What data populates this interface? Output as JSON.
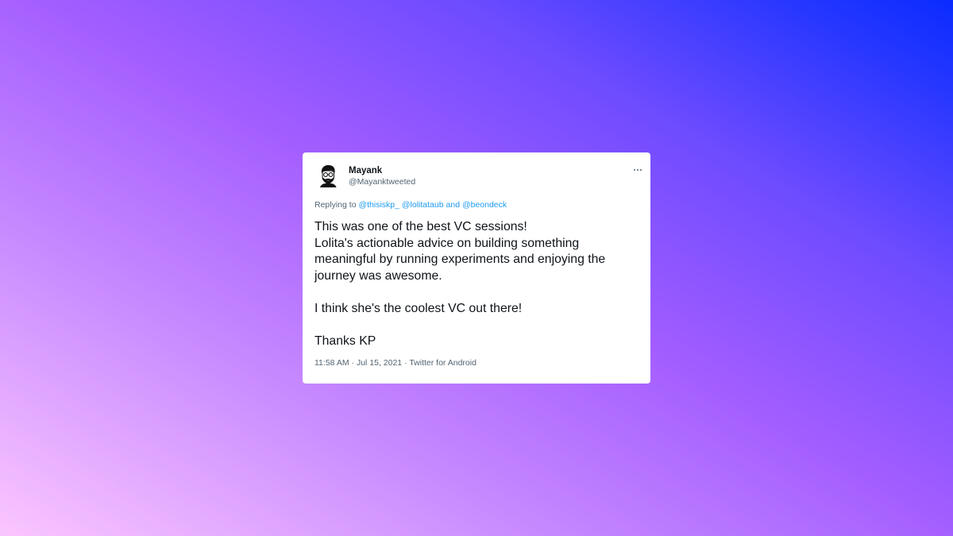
{
  "colors": {
    "background_gradient": [
      "#fbc6ff",
      "#a35dff",
      "#0a2bff"
    ],
    "card": "#ffffff",
    "text_primary": "#0f1419",
    "text_secondary": "#536471",
    "link": "#1d9bf0"
  },
  "tweet": {
    "author": {
      "name": "Mayank",
      "handle": "@Mayanktweeted",
      "avatar_icon": "bearded-man-avatar-icon"
    },
    "more_icon": "more-horizontal-icon",
    "reply": {
      "prefix": "Replying to ",
      "mentions": [
        "@thisiskp_",
        "@lolitataub"
      ],
      "conjunction": " and ",
      "last_mention": "@beondeck"
    },
    "text_lines": [
      "This was one of the best VC sessions!",
      "Lolita's actionable advice on building something",
      "meaningful by running experiments and enjoying the",
      "journey was awesome.",
      "",
      "I think she's the coolest VC out there!",
      "",
      "Thanks KP"
    ],
    "time": "11:58 AM",
    "separator": " · ",
    "date": "Jul 15, 2021",
    "source": "Twitter for Android"
  }
}
